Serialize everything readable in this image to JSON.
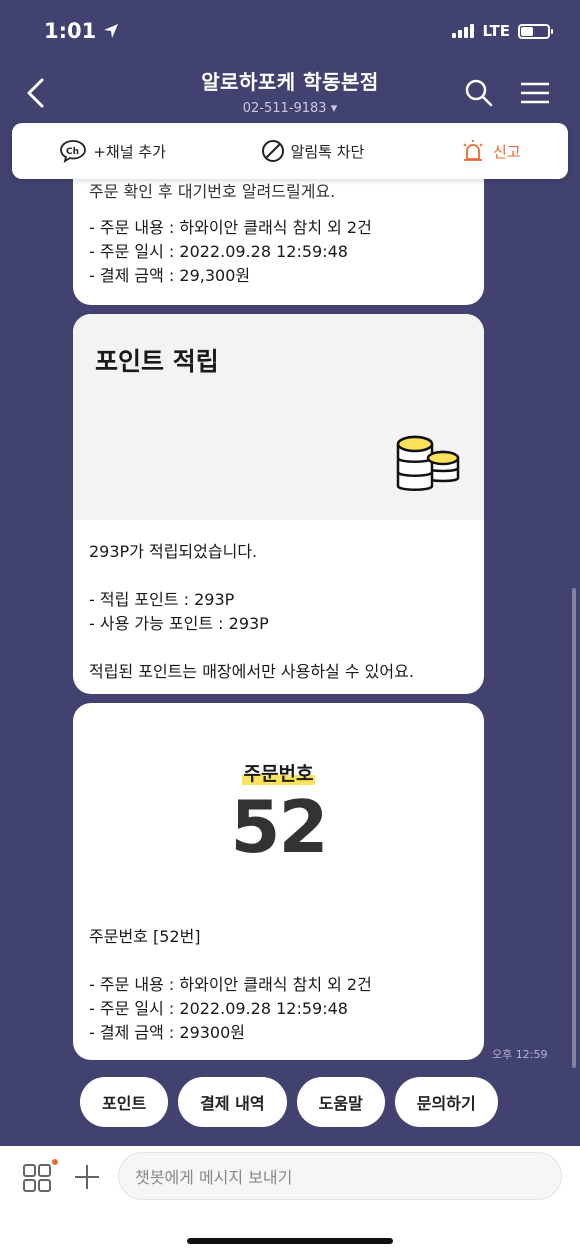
{
  "status": {
    "time": "1:01",
    "network": "LTE"
  },
  "header": {
    "title": "알로하포케 학동본점",
    "phone": "02-511-9183"
  },
  "channel_bar": {
    "add_channel": "+채널 추가",
    "block": "알림톡 차단",
    "report": "신고",
    "ch_badge": "Ch"
  },
  "messages": {
    "m1": {
      "cut_text": "주문 확인 후 대기번호 알려드릴게요.",
      "lines": [
        "- 주문 내용 : 하와이안 클래식 참치 외 2건",
        "- 주문 일시 : 2022.09.28 12:59:48",
        "- 결제 금액 : 29,300원"
      ]
    },
    "m2": {
      "title": "포인트 적립",
      "body": "293P가 적립되었습니다.\n\n- 적립 포인트 : 293P\n- 사용 가능 포인트 : 293P\n\n적립된 포인트는 매장에서만 사용하실 수 있어요."
    },
    "m3": {
      "label": "주문번호",
      "number": "52",
      "body": "주문번호 [52번]\n\n- 주문 내용 : 하와이안 클래식 참치 외 2건\n- 주문 일시 : 2022.09.28 12:59:48\n- 결제 금액 : 29300원"
    },
    "timestamp": "오후 12:59"
  },
  "quick_replies": [
    "포인트",
    "결제 내역",
    "도움말",
    "문의하기"
  ],
  "composer": {
    "placeholder": "챗봇에게 메시지 보내기"
  },
  "colors": {
    "background": "#424271",
    "accent": "#fde35b",
    "report": "#ee6a2b"
  }
}
